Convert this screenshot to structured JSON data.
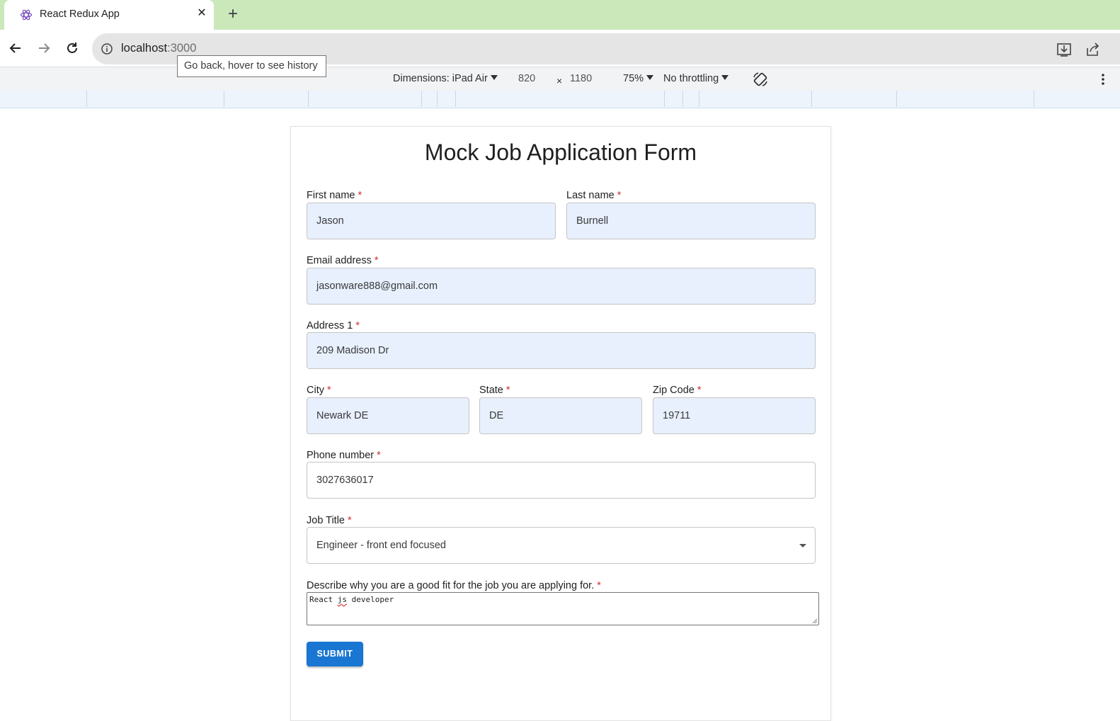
{
  "browser": {
    "tab": {
      "title": "React Redux App",
      "favicon": "react-logo-icon"
    },
    "new_tab_label": "+",
    "url": {
      "host": "localhost",
      "port": ":3000"
    },
    "tooltip": "Go back, hover to see history"
  },
  "device_toolbar": {
    "dimensions_label": "Dimensions: iPad Air",
    "width": "820",
    "times": "×",
    "height": "1180",
    "zoom": "75%",
    "throttling": "No throttling"
  },
  "form": {
    "title": "Mock Job Application Form",
    "required_marker": "*",
    "first_name": {
      "label": "First name",
      "value": "Jason"
    },
    "last_name": {
      "label": "Last name",
      "value": "Burnell"
    },
    "email": {
      "label": "Email address",
      "value": "jasonware888@gmail.com"
    },
    "address1": {
      "label": "Address 1",
      "value": "209 Madison Dr"
    },
    "city": {
      "label": "City",
      "value": "Newark DE"
    },
    "state": {
      "label": "State",
      "value": "DE"
    },
    "zip": {
      "label": "Zip Code",
      "value": "19711"
    },
    "phone": {
      "label": "Phone number",
      "value": "3027636017"
    },
    "job_title": {
      "label": "Job Title",
      "value": "Engineer - front end focused"
    },
    "describe": {
      "label": "Describe why you are a good fit for the job you are applying for.",
      "value_before": "React ",
      "value_misspelled": "js",
      "value_after": " developer"
    },
    "submit_label": "SUBMIT"
  },
  "colors": {
    "tab_strip": "#cbe8bb",
    "autofill_bg": "#e8f0fe",
    "submit_bg": "#1976d2",
    "required": "#d32f2f"
  }
}
